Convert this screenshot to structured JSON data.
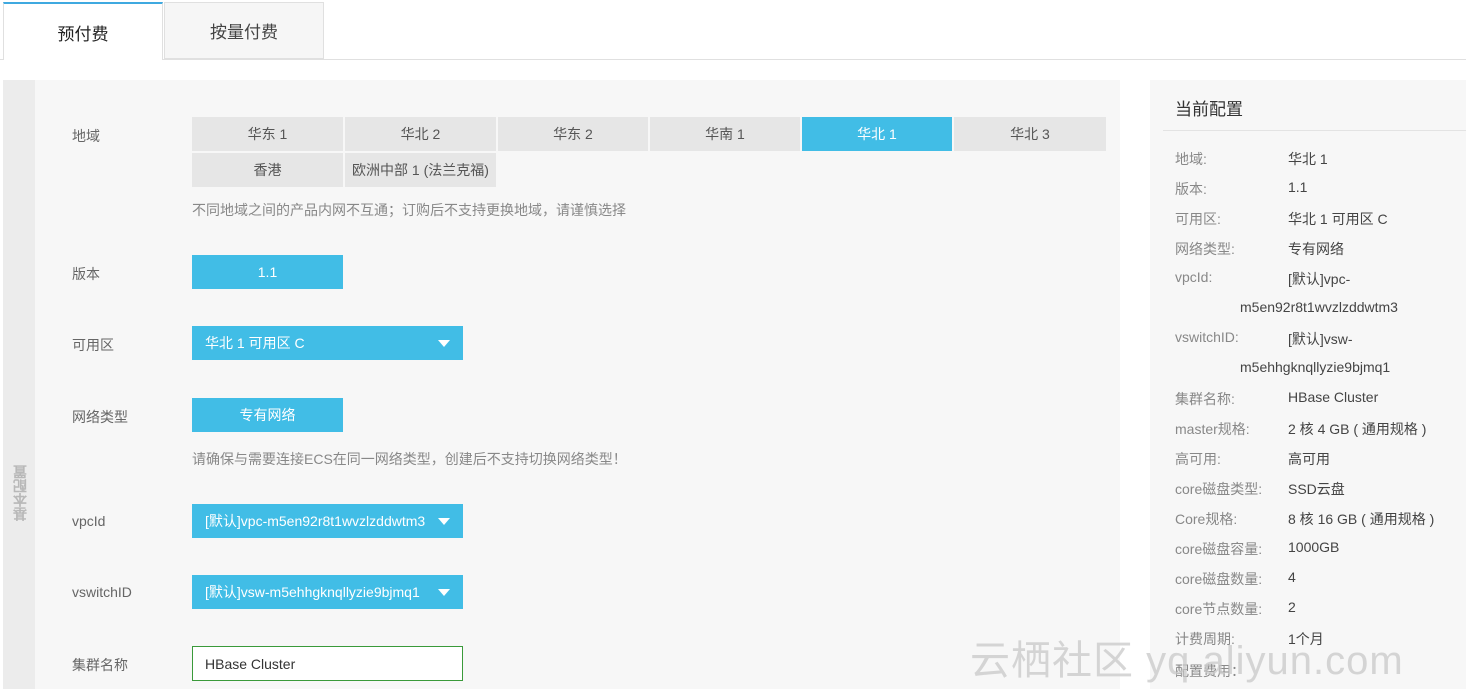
{
  "tabs": [
    {
      "label": "预付费",
      "active": true
    },
    {
      "label": "按量付费",
      "active": false
    }
  ],
  "sidebar_label": "基本配置",
  "form": {
    "region": {
      "label": "地域",
      "options": [
        "华东 1",
        "华北 2",
        "华东 2",
        "华南 1",
        "华北 1",
        "华北 3",
        "香港",
        "欧洲中部 1 (法兰克福)"
      ],
      "selected": "华北 1",
      "hint": "不同地域之间的产品内网不互通；订购后不支持更换地域，请谨慎选择"
    },
    "version": {
      "label": "版本",
      "value": "1.1"
    },
    "zone": {
      "label": "可用区",
      "value": "华北 1 可用区 C"
    },
    "network": {
      "label": "网络类型",
      "value": "专有网络",
      "hint": "请确保与需要连接ECS在同一网络类型，创建后不支持切换网络类型！"
    },
    "vpcid": {
      "label": "vpcId",
      "value": "[默认]vpc-m5en92r8t1wvzlzddwtm3"
    },
    "vswitch": {
      "label": "vswitchID",
      "value": "[默认]vsw-m5ehhgknqllyzie9bjmq1"
    },
    "cluster_name": {
      "label": "集群名称",
      "value": "HBase Cluster"
    }
  },
  "summary": {
    "title": "当前配置",
    "rows": [
      {
        "label": "地域:",
        "value": "华北 1"
      },
      {
        "label": "版本:",
        "value": "1.1"
      },
      {
        "label": "可用区:",
        "value": "华北 1 可用区 C"
      },
      {
        "label": "网络类型:",
        "value": "专有网络"
      },
      {
        "label": "vpcId:",
        "value": "[默认]vpc-",
        "cont": "m5en92r8t1wvzlzddwtm3"
      },
      {
        "label": "vswitchID:",
        "value": "[默认]vsw-",
        "cont": "m5ehhgknqllyzie9bjmq1"
      },
      {
        "label": "集群名称:",
        "value": "HBase Cluster"
      },
      {
        "label": "master规格:",
        "value": "2 核 4 GB ( 通用规格 )"
      },
      {
        "label": "高可用:",
        "value": "高可用"
      },
      {
        "label": "core磁盘类型:",
        "value": "SSD云盘"
      },
      {
        "label": "Core规格:",
        "value": "8 核 16 GB ( 通用规格 )"
      },
      {
        "label": "core磁盘容量:",
        "value": "1000GB"
      },
      {
        "label": "core磁盘数量:",
        "value": "4"
      },
      {
        "label": "core节点数量:",
        "value": "2"
      },
      {
        "label": "计费周期:",
        "value": "1个月"
      },
      {
        "label": "配置费用：",
        "value": ""
      }
    ]
  },
  "watermark": "云栖社区 yq.aliyun.com"
}
